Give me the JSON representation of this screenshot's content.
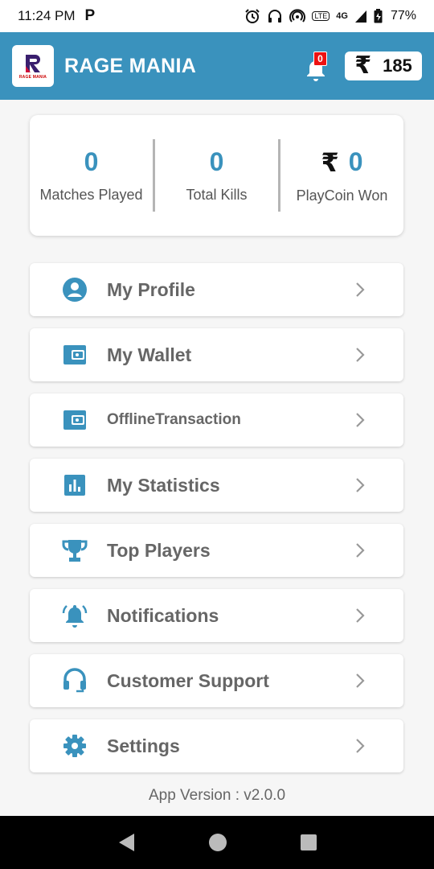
{
  "status_bar": {
    "time": "11:24 PM",
    "notification_icon": "P",
    "network": "4G",
    "battery": "77%",
    "volte": "LTE"
  },
  "header": {
    "app_name": "RAGE MANIA",
    "logo_text": "RAGE MANIA",
    "notification_count": "0",
    "currency_symbol": "₹",
    "coin_balance": "185"
  },
  "stats": [
    {
      "value": "0",
      "label": "Matches Played"
    },
    {
      "value": "0",
      "label": "Total Kills"
    },
    {
      "value": "0",
      "label": "PlayCoin Won",
      "currency_symbol": "₹"
    }
  ],
  "menu": [
    {
      "label": "My Profile",
      "icon": "account-circle-icon"
    },
    {
      "label": "My Wallet",
      "icon": "wallet-icon"
    },
    {
      "label": "OfflineTransaction",
      "icon": "wallet-icon"
    },
    {
      "label": "My Statistics",
      "icon": "bar-chart-icon"
    },
    {
      "label": "Top Players",
      "icon": "trophy-icon"
    },
    {
      "label": "Notifications",
      "icon": "bell-ringing-icon"
    },
    {
      "label": "Customer Support",
      "icon": "headset-icon"
    },
    {
      "label": "Settings",
      "icon": "gear-icon"
    }
  ],
  "footer": {
    "version": "App Version : v2.0.0"
  },
  "colors": {
    "primary": "#3a92bd",
    "badge": "#e11111",
    "text_gray": "#666666"
  }
}
